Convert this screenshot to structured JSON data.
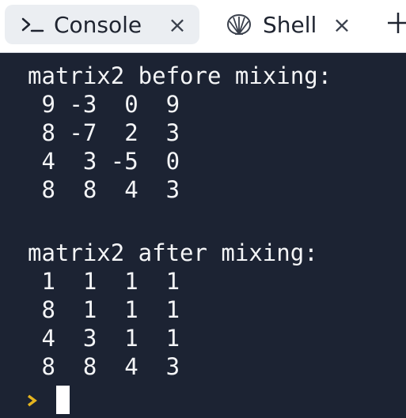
{
  "tabs": [
    {
      "label": "Console",
      "icon": "console-prompt-icon",
      "active": true,
      "close_glyph": "×"
    },
    {
      "label": "Shell",
      "icon": "shell-icon",
      "active": false,
      "close_glyph": "×"
    }
  ],
  "new_tab": {
    "icon": "plus-icon"
  },
  "terminal": {
    "lines": [
      "matrix2 before mixing:",
      " 9 -3  0  9",
      " 8 -7  2  3",
      " 4  3 -5  0",
      " 8  8  4  3",
      "",
      "matrix2 after mixing:",
      " 1  1  1  1",
      " 8  1  1  1",
      " 4  3  1  1",
      " 8  8  4  3"
    ],
    "prompt_icon": "prompt-chevron-icon",
    "colors": {
      "background": "#1c2333",
      "text": "#f4f5f7",
      "prompt": "#e5b41f",
      "cursor": "#ffffff"
    }
  }
}
